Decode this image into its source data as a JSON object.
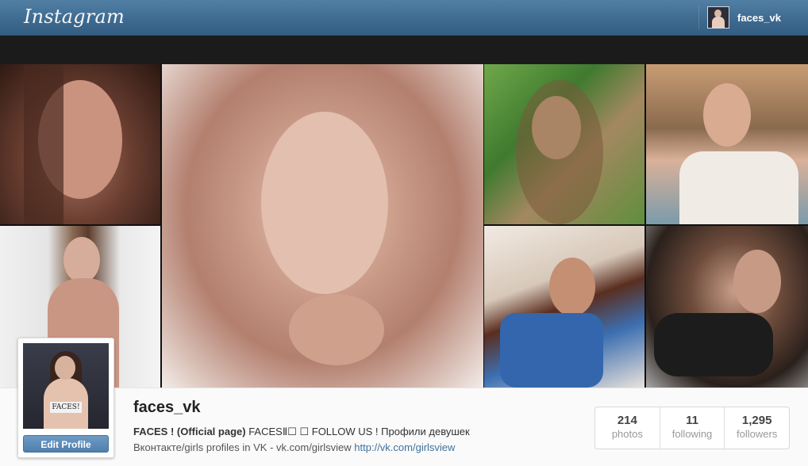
{
  "header": {
    "logo": "Instagram",
    "username": "faces_vk"
  },
  "cover": {
    "tiles": [
      {
        "name": "cover-photo-1"
      },
      {
        "name": "cover-photo-2"
      },
      {
        "name": "cover-photo-main"
      },
      {
        "name": "cover-photo-3"
      },
      {
        "name": "cover-photo-4"
      },
      {
        "name": "cover-photo-5"
      },
      {
        "name": "cover-photo-6"
      }
    ]
  },
  "profile": {
    "avatar_tag": "FACES!",
    "edit_label": "Edit Profile",
    "username": "faces_vk",
    "bio_title": "FACES ! (Official page)",
    "bio_rest": "FACESⅡ☐ ☐ FOLLOW US ! Профили девушек",
    "bio_line2": "Вконтакте/girls profiles in VK - vk.com/girlsview",
    "link": "http://vk.com/girlsview"
  },
  "stats": [
    {
      "value": "214",
      "label": "photos"
    },
    {
      "value": "11",
      "label": "following"
    },
    {
      "value": "1,295",
      "label": "followers"
    }
  ]
}
